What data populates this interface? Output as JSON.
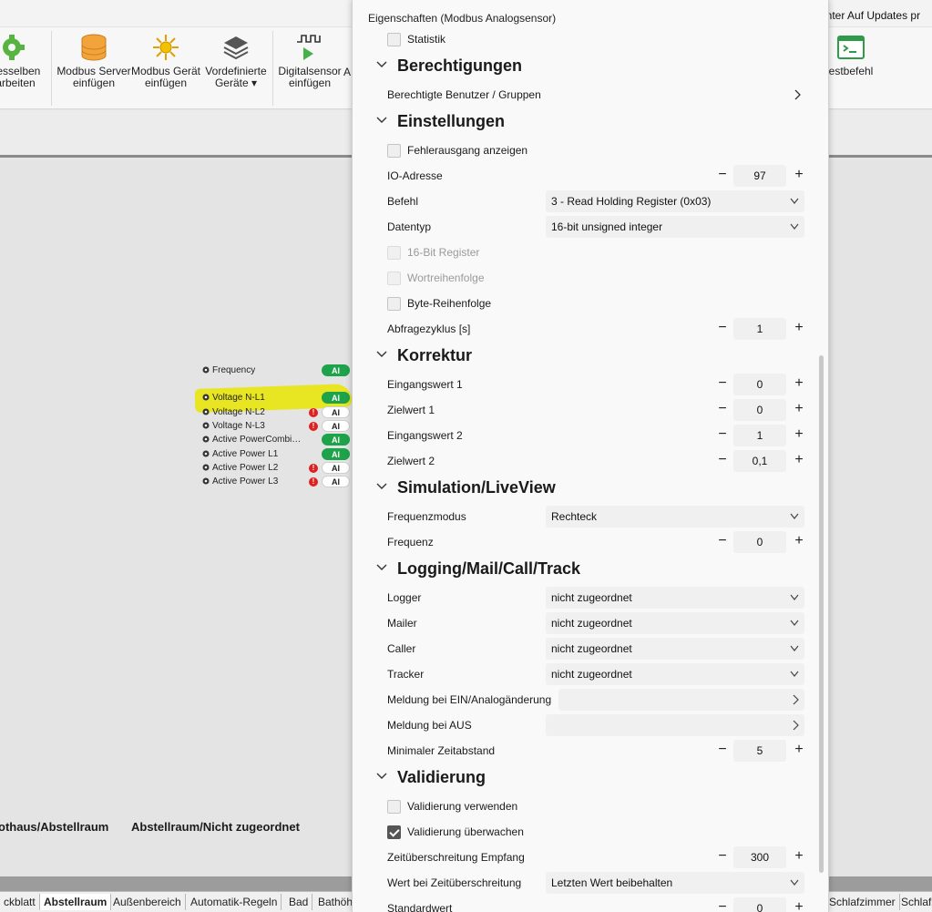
{
  "ribbon": {
    "buttons": [
      {
        "label": "desselben\narbeiten",
        "icon": "gear-icon"
      },
      {
        "label": "Modbus Server\neinfügen",
        "icon": "database-icon"
      },
      {
        "label": "Modbus Gerät\neinfügen",
        "icon": "device-icon"
      },
      {
        "label": "Vordefinierte\nGeräte ▾",
        "icon": "layers-icon"
      },
      {
        "label": "Digitalsensor\neinfügen",
        "icon": "digital-signal-icon"
      },
      {
        "label": "A",
        "icon": ""
      },
      {
        "label": "estbefehl",
        "icon": "console-icon"
      }
    ],
    "top_right_text": "enter   Auf Updates pr"
  },
  "canvas": {
    "path_left": "othaus/Abstellraum",
    "path_right": "Abstellraum/Nicht zugeordnet",
    "sensors": [
      {
        "name": "Frequency",
        "badge": "AI",
        "green": true,
        "warning": false
      },
      {
        "name": "Voltage N-L1",
        "badge": "AI",
        "green": true,
        "warning": false
      },
      {
        "name": "Voltage N-L2",
        "badge": "AI",
        "green": false,
        "warning": true
      },
      {
        "name": "Voltage N-L3",
        "badge": "AI",
        "green": false,
        "warning": true
      },
      {
        "name": "Active PowerCombi…",
        "badge": "AI",
        "green": true,
        "warning": false
      },
      {
        "name": "Active Power L1",
        "badge": "AI",
        "green": true,
        "warning": false
      },
      {
        "name": "Active Power L2",
        "badge": "AI",
        "green": false,
        "warning": true
      },
      {
        "name": "Active Power L3",
        "badge": "AI",
        "green": false,
        "warning": true
      }
    ],
    "warning_glyph": "!"
  },
  "bottom_tabs": [
    "ckblatt",
    "Abstellraum",
    "Außenbereich",
    "Automatik-Regeln",
    "Bad",
    "Bathöh",
    "Schlafzimmer",
    "Schlafz"
  ],
  "panel": {
    "title": "Eigenschaften (Modbus Analogsensor)",
    "statistik": "Statistik",
    "sections": {
      "berechtigungen": "Berechtigungen",
      "einstellungen": "Einstellungen",
      "korrektur": "Korrektur",
      "simulation": "Simulation/LiveView",
      "logging": "Logging/Mail/Call/Track",
      "validierung": "Validierung"
    },
    "berechtigte": "Berechtigte Benutzer / Gruppen",
    "fehlerausgang": "Fehlerausgang anzeigen",
    "io_adresse": {
      "label": "IO-Adresse",
      "value": "97"
    },
    "befehl": {
      "label": "Befehl",
      "value": "3 - Read Holding Register (0x03)"
    },
    "datentyp": {
      "label": "Datentyp",
      "value": "16-bit unsigned integer"
    },
    "bit16": "16-Bit Register",
    "wortreihenfolge": "Wortreihenfolge",
    "bytereihenfolge": "Byte-Reihenfolge",
    "abfragezyklus": {
      "label": "Abfragezyklus [s]",
      "value": "1"
    },
    "eingangswert1": {
      "label": "Eingangswert 1",
      "value": "0"
    },
    "zielwert1": {
      "label": "Zielwert 1",
      "value": "0"
    },
    "eingangswert2": {
      "label": "Eingangswert 2",
      "value": "1"
    },
    "zielwert2": {
      "label": "Zielwert 2",
      "value": "0,1"
    },
    "frequenzmodus": {
      "label": "Frequenzmodus",
      "value": "Rechteck"
    },
    "frequenz": {
      "label": "Frequenz",
      "value": "0"
    },
    "logger": {
      "label": "Logger",
      "value": "nicht zugeordnet"
    },
    "mailer": {
      "label": "Mailer",
      "value": "nicht zugeordnet"
    },
    "caller": {
      "label": "Caller",
      "value": "nicht zugeordnet"
    },
    "tracker": {
      "label": "Tracker",
      "value": "nicht zugeordnet"
    },
    "meldung_ein": "Meldung bei EIN/Analogänderung",
    "meldung_aus": "Meldung bei AUS",
    "min_zeitabstand": {
      "label": "Minimaler Zeitabstand",
      "value": "5"
    },
    "validierung_verwenden": "Validierung verwenden",
    "validierung_ueberwachen": "Validierung überwachen",
    "zeitueberschreitung": {
      "label": "Zeitüberschreitung Empfang",
      "value": "300"
    },
    "wert_bei": {
      "label": "Wert bei Zeitüberschreitung",
      "value": "Letzten Wert beibehalten"
    },
    "standardwert": {
      "label": "Standardwert",
      "value": "0"
    },
    "minus": "−",
    "plus": "+"
  }
}
